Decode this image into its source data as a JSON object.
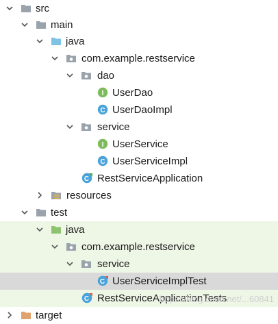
{
  "tree": {
    "rows": [
      {
        "label": "src"
      },
      {
        "label": "main"
      },
      {
        "label": "java"
      },
      {
        "label": "com.example.restservice"
      },
      {
        "label": "dao"
      },
      {
        "label": "UserDao"
      },
      {
        "label": "UserDaoImpl"
      },
      {
        "label": "service"
      },
      {
        "label": "UserService"
      },
      {
        "label": "UserServiceImpl"
      },
      {
        "label": "RestServiceApplication"
      },
      {
        "label": "resources"
      },
      {
        "label": "test"
      },
      {
        "label": "java"
      },
      {
        "label": "com.example.restservice"
      },
      {
        "label": "service"
      },
      {
        "label": "UserServiceImplTest"
      },
      {
        "label": "RestServiceApplicationTests"
      },
      {
        "label": "target"
      }
    ]
  },
  "watermark": "https://blog.csdn.net/...60841",
  "colors": {
    "folder_gray": "#9aa3ab",
    "source_blue": "#7ec3e6",
    "test_green": "#8dc26f",
    "interface_green": "#7dbb5d",
    "class_blue": "#4aa3d8",
    "selection": "#d9d9d9",
    "test_bg": "#eef6e6"
  }
}
